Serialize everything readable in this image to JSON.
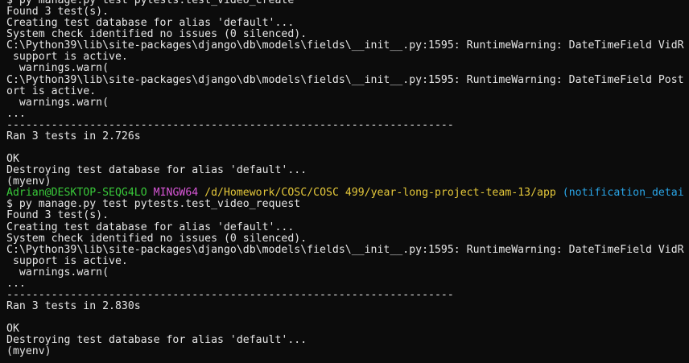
{
  "terminal": {
    "colors": {
      "background": "#0c0c0c",
      "text": "#e6e6e6",
      "user": "#39c93a",
      "shell": "#d957d8",
      "path": "#e5c83a",
      "branch": "#2aa6e8"
    },
    "lines": [
      {
        "segments": [
          {
            "text": "$ py manage.py test pytests.test_video_create",
            "cls": ""
          },
          {
            "text": "                                         ",
            "cls": ""
          }
        ]
      },
      {
        "segments": [
          {
            "text": "Found 3 test(s).",
            "cls": ""
          }
        ]
      },
      {
        "segments": [
          {
            "text": "Creating test database for alias 'default'...",
            "cls": ""
          }
        ]
      },
      {
        "segments": [
          {
            "text": "System check identified no issues (0 silenced).",
            "cls": ""
          }
        ]
      },
      {
        "segments": [
          {
            "text": "C:\\Python39\\lib\\site-packages\\django\\db\\models\\fields\\__init__.py:1595: RuntimeWarning: DateTimeField VidR",
            "cls": ""
          }
        ]
      },
      {
        "segments": [
          {
            "text": " support is active.",
            "cls": ""
          }
        ]
      },
      {
        "segments": [
          {
            "text": "  warnings.warn(",
            "cls": ""
          }
        ]
      },
      {
        "segments": [
          {
            "text": "C:\\Python39\\lib\\site-packages\\django\\db\\models\\fields\\__init__.py:1595: RuntimeWarning: DateTimeField Post",
            "cls": ""
          }
        ]
      },
      {
        "segments": [
          {
            "text": "ort is active.",
            "cls": ""
          }
        ]
      },
      {
        "segments": [
          {
            "text": "  warnings.warn(",
            "cls": ""
          }
        ]
      },
      {
        "segments": [
          {
            "text": "...",
            "cls": ""
          }
        ]
      },
      {
        "segments": [
          {
            "text": "----------------------------------------------------------------------",
            "cls": ""
          }
        ]
      },
      {
        "segments": [
          {
            "text": "Ran 3 tests in 2.726s",
            "cls": ""
          }
        ]
      },
      {
        "segments": [
          {
            "text": "",
            "cls": ""
          }
        ]
      },
      {
        "segments": [
          {
            "text": "OK",
            "cls": ""
          }
        ]
      },
      {
        "segments": [
          {
            "text": "Destroying test database for alias 'default'...",
            "cls": ""
          }
        ]
      },
      {
        "segments": [
          {
            "text": "(myenv)",
            "cls": ""
          }
        ]
      },
      {
        "segments": [
          {
            "text": "Adrian@DESKTOP-SEQG4LO",
            "cls": "c-user"
          },
          {
            "text": " ",
            "cls": ""
          },
          {
            "text": "MINGW64",
            "cls": "c-shell"
          },
          {
            "text": " ",
            "cls": ""
          },
          {
            "text": "/d/Homework/COSC/COSC 499/year-long-project-team-13/app",
            "cls": "c-path"
          },
          {
            "text": " ",
            "cls": ""
          },
          {
            "text": "(notification_detai",
            "cls": "c-branch"
          }
        ]
      },
      {
        "segments": [
          {
            "text": "$ py manage.py test pytests.test_video_request",
            "cls": ""
          }
        ]
      },
      {
        "segments": [
          {
            "text": "Found 3 test(s).",
            "cls": ""
          }
        ]
      },
      {
        "segments": [
          {
            "text": "Creating test database for alias 'default'...",
            "cls": ""
          }
        ]
      },
      {
        "segments": [
          {
            "text": "System check identified no issues (0 silenced).",
            "cls": ""
          }
        ]
      },
      {
        "segments": [
          {
            "text": "C:\\Python39\\lib\\site-packages\\django\\db\\models\\fields\\__init__.py:1595: RuntimeWarning: DateTimeField VidR",
            "cls": ""
          }
        ]
      },
      {
        "segments": [
          {
            "text": " support is active.",
            "cls": ""
          }
        ]
      },
      {
        "segments": [
          {
            "text": "  warnings.warn(",
            "cls": ""
          }
        ]
      },
      {
        "segments": [
          {
            "text": "...",
            "cls": ""
          }
        ]
      },
      {
        "segments": [
          {
            "text": "----------------------------------------------------------------------",
            "cls": ""
          }
        ]
      },
      {
        "segments": [
          {
            "text": "Ran 3 tests in 2.830s",
            "cls": ""
          }
        ]
      },
      {
        "segments": [
          {
            "text": "",
            "cls": ""
          }
        ]
      },
      {
        "segments": [
          {
            "text": "OK",
            "cls": ""
          }
        ]
      },
      {
        "segments": [
          {
            "text": "Destroying test database for alias 'default'...",
            "cls": ""
          }
        ]
      },
      {
        "segments": [
          {
            "text": "(myenv)",
            "cls": ""
          }
        ]
      }
    ]
  }
}
